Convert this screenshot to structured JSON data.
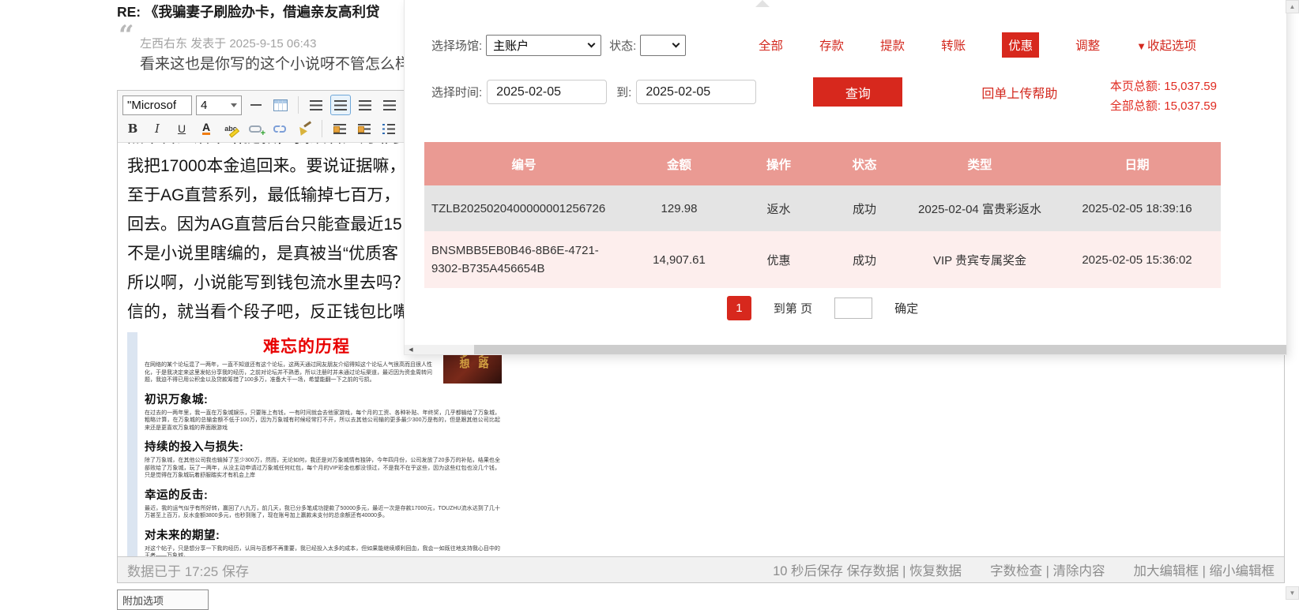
{
  "page": {
    "title": "RE: 《我骗妻子刷脸办卡，借遍亲友高利贷"
  },
  "quote": {
    "author_line": "左西右东 发表于 2025-9-15 06:43",
    "content": "看来这也是你写的这个小说呀不管怎么样"
  },
  "editor": {
    "toolbar": {
      "font_name": "\"Microsof",
      "font_size": "4",
      "emoticon_label": "表"
    },
    "lines": [
      "黑平台死活不给提款，我顶着压力非要让",
      "我把17000本金追回来。要说证据嘛，",
      "至于AG直营系列，最低输掉七百万，",
      "回去。因为AG直营后台只能查最近15",
      "不是小说里瞎编的，是真被当“优质客",
      "所以啊，小说能写到钱包流水里去吗？",
      "信的，就当看个段子吧，反正钱包比嘴"
    ],
    "footer": {
      "saved": "数据已于 17:25 保存",
      "parts": [
        "10 秒后保存 保存数据 | 恢复数据",
        "字数检查 | 清除内容",
        "加大编辑框 | 缩小编辑框"
      ]
    }
  },
  "article": {
    "title": "难忘的历程",
    "thumb": [
      "梦想",
      "之路"
    ],
    "intro": "在网络的某个论坛混了一两年，一直不知道还有这个论坛，这两天通过网友朋友介绍得知这个论坛人气很高而且很人性化，于是我决定来这里发帖分享我的经历，之前对论坛并不熟悉，所以注册时并未通过论坛渠道，最近因为资金周转问题，我迫不得已用公积金以及贷款筹措了100多万，准备大干一场，希望能翻一下之前的亏损。",
    "sections": [
      {
        "heading": "初识万象城:",
        "body": "在过去的一两年里，我一直在万象城娱乐，只要账上有钱，一有时间就会去他家游戏，每个月的工资、各种补贴、年终奖，几乎都输给了万象城，粗略计算，在万象城的总输金额不低于100万，因为万象城有时候经常打不开，所以去其他公司输的更多最少300万是有的，但是跟其他公司比起来还是更喜欢万象城的界面跟游戏"
      },
      {
        "heading": "持续的投入与损失:",
        "body": "除了万象城，在其他公司我也输掉了至少300万，然而，无论如何，我还是对万象城情有独钟，今年四月份，公司发放了20多万的补贴，结果也全部败给了万象城，玩了一两年，从没主动申请过万象城任何红包，每个月的VIP彩金也都没领过，不是我不在乎这些，因为这些红包也没几个钱，只是觉得在万象城玩着舒服踏实才有机会上岸"
      },
      {
        "heading": "幸运的反击:",
        "body": "最近，我的运气似乎有所好转，赢回了八九万，前几天，我已分多笔成功提款了50000多元，最近一次是存款17000元，TOUZHU流水达到了几十万甚至上百万，反水金额3800多元，也秒到账了，现在账号加上赢款未支付的总余额还有40000多。"
      },
      {
        "heading": "对未来的期望:",
        "body": "对这个帖子，只是想分享一下我的经历，认同与否都不再重要，我已经投入太多的成本，但如果能继续顺利回血，我会一如既往地支持我心目中的王者——万象城。"
      }
    ]
  },
  "panel": {
    "filters": {
      "venue_label": "选择场馆:",
      "venue_value": "主账户",
      "status_label": "状态:",
      "status_value": "",
      "time_label": "选择时间:",
      "time_from": "2025-02-05",
      "to_label": "到:",
      "time_to": "2025-02-05"
    },
    "query_label": "查询",
    "receipt_help": "回单上传帮助",
    "tabs": [
      "全部",
      "存款",
      "提款",
      "转账",
      "优惠",
      "调整"
    ],
    "collapse_label": "收起选项",
    "totals": {
      "page_label": "本页总额:",
      "page_value": "15,037.59",
      "all_label": "全部总额:",
      "all_value": "15,037.59"
    },
    "table": {
      "headers": [
        "编号",
        "金额",
        "操作",
        "状态",
        "类型",
        "日期"
      ],
      "rows": [
        [
          "TZLB2025020400000001256726",
          "129.98",
          "返水",
          "成功",
          "2025-02-04 富贵彩返水",
          "2025-02-05 18:39:16"
        ],
        [
          "BNSMBB5EB0B46-8B6E-4721-9302-B735A456654B",
          "14,907.61",
          "优惠",
          "成功",
          "VIP 贵宾专属奖金",
          "2025-02-05 15:36:02"
        ]
      ]
    },
    "pager": {
      "page": "1",
      "goto_label": "到第 页",
      "confirm_label": "确定"
    }
  },
  "misc": {
    "bottom_partial": "附加选项"
  },
  "colors": {
    "accent_red": "#d7281d",
    "link_red": "#d3281e",
    "table_header": "#ea9a93",
    "row_gray": "#e4e4e4",
    "row_pink": "#fdeeed"
  }
}
